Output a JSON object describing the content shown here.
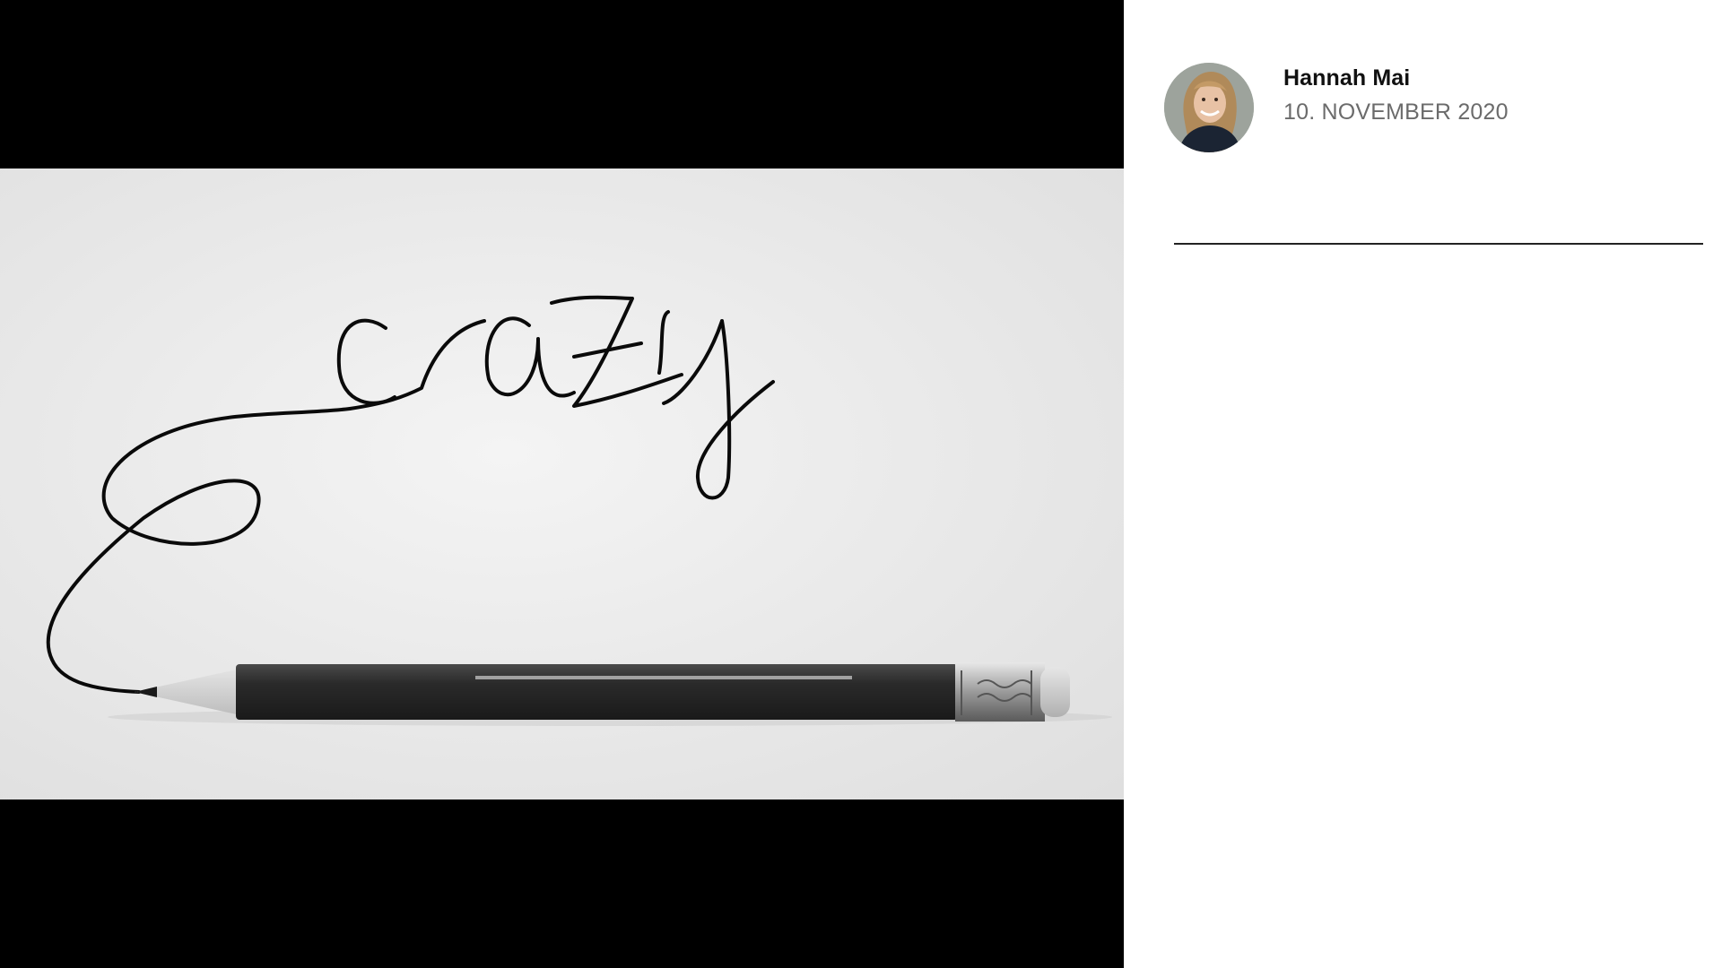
{
  "post": {
    "author": {
      "name": "Hannah Mai",
      "avatar_icon": "author-portrait-photo"
    },
    "date": "10. NOVEMBER 2020"
  },
  "image": {
    "handwritten_word": "crazy"
  },
  "colors": {
    "viewer_background": "#000000",
    "sidebar_background": "#ffffff",
    "date_text": "#6b6b6b",
    "author_text": "#111111",
    "divider": "#222222"
  }
}
